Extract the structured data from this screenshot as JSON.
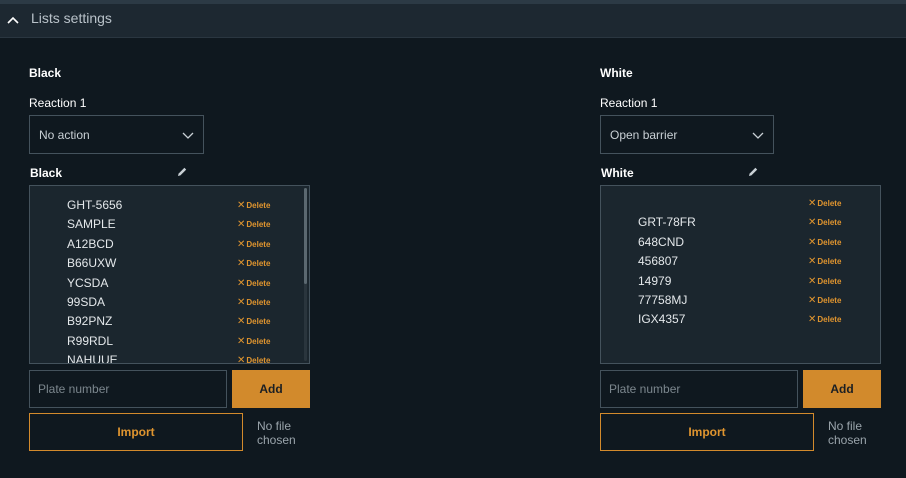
{
  "header": {
    "title": "Lists settings",
    "toggle_icon": "chevron-up-icon"
  },
  "black": {
    "section_title": "Black",
    "reaction_label": "Reaction 1",
    "reaction_value": "No action",
    "list_title": "Black",
    "items": [
      "GHT-5656",
      "SAMPLE",
      "A12BCD",
      "B66UXW",
      "YCSDA",
      "99SDA",
      "B92PNZ",
      "R99RDL",
      "NAHUUE"
    ],
    "delete_label": "Delete",
    "placeholder": "Plate number",
    "add_label": "Add",
    "import_label": "Import",
    "no_file": "No file chosen"
  },
  "white": {
    "section_title": "White",
    "reaction_label": "Reaction 1",
    "reaction_value": "Open barrier",
    "list_title": "White",
    "items": [
      "",
      "GRT-78FR",
      "648CND",
      "456807",
      "14979",
      "77758MJ",
      "IGX4357"
    ],
    "delete_label": "Delete",
    "placeholder": "Plate number",
    "add_label": "Add",
    "import_label": "Import",
    "no_file": "No file chosen"
  },
  "colors": {
    "accent": "#d28a2c",
    "background": "#0f181f",
    "panel": "#1b262e",
    "header": "#1d2831"
  }
}
